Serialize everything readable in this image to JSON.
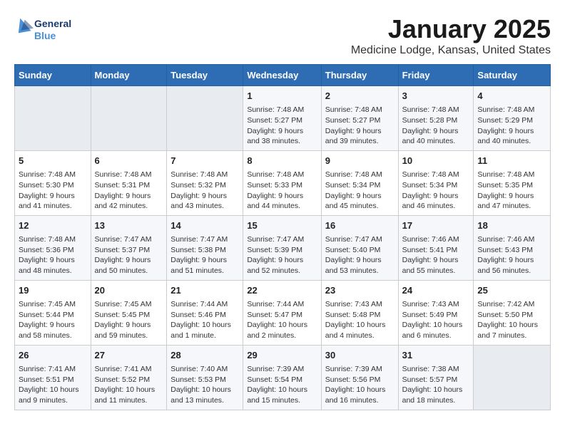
{
  "header": {
    "logo_line1": "General",
    "logo_line2": "Blue",
    "title": "January 2025",
    "subtitle": "Medicine Lodge, Kansas, United States"
  },
  "days_of_week": [
    "Sunday",
    "Monday",
    "Tuesday",
    "Wednesday",
    "Thursday",
    "Friday",
    "Saturday"
  ],
  "weeks": [
    [
      {
        "day": "",
        "info": ""
      },
      {
        "day": "",
        "info": ""
      },
      {
        "day": "",
        "info": ""
      },
      {
        "day": "1",
        "info": "Sunrise: 7:48 AM\nSunset: 5:27 PM\nDaylight: 9 hours and 38 minutes."
      },
      {
        "day": "2",
        "info": "Sunrise: 7:48 AM\nSunset: 5:27 PM\nDaylight: 9 hours and 39 minutes."
      },
      {
        "day": "3",
        "info": "Sunrise: 7:48 AM\nSunset: 5:28 PM\nDaylight: 9 hours and 40 minutes."
      },
      {
        "day": "4",
        "info": "Sunrise: 7:48 AM\nSunset: 5:29 PM\nDaylight: 9 hours and 40 minutes."
      }
    ],
    [
      {
        "day": "5",
        "info": "Sunrise: 7:48 AM\nSunset: 5:30 PM\nDaylight: 9 hours and 41 minutes."
      },
      {
        "day": "6",
        "info": "Sunrise: 7:48 AM\nSunset: 5:31 PM\nDaylight: 9 hours and 42 minutes."
      },
      {
        "day": "7",
        "info": "Sunrise: 7:48 AM\nSunset: 5:32 PM\nDaylight: 9 hours and 43 minutes."
      },
      {
        "day": "8",
        "info": "Sunrise: 7:48 AM\nSunset: 5:33 PM\nDaylight: 9 hours and 44 minutes."
      },
      {
        "day": "9",
        "info": "Sunrise: 7:48 AM\nSunset: 5:34 PM\nDaylight: 9 hours and 45 minutes."
      },
      {
        "day": "10",
        "info": "Sunrise: 7:48 AM\nSunset: 5:34 PM\nDaylight: 9 hours and 46 minutes."
      },
      {
        "day": "11",
        "info": "Sunrise: 7:48 AM\nSunset: 5:35 PM\nDaylight: 9 hours and 47 minutes."
      }
    ],
    [
      {
        "day": "12",
        "info": "Sunrise: 7:48 AM\nSunset: 5:36 PM\nDaylight: 9 hours and 48 minutes."
      },
      {
        "day": "13",
        "info": "Sunrise: 7:47 AM\nSunset: 5:37 PM\nDaylight: 9 hours and 50 minutes."
      },
      {
        "day": "14",
        "info": "Sunrise: 7:47 AM\nSunset: 5:38 PM\nDaylight: 9 hours and 51 minutes."
      },
      {
        "day": "15",
        "info": "Sunrise: 7:47 AM\nSunset: 5:39 PM\nDaylight: 9 hours and 52 minutes."
      },
      {
        "day": "16",
        "info": "Sunrise: 7:47 AM\nSunset: 5:40 PM\nDaylight: 9 hours and 53 minutes."
      },
      {
        "day": "17",
        "info": "Sunrise: 7:46 AM\nSunset: 5:41 PM\nDaylight: 9 hours and 55 minutes."
      },
      {
        "day": "18",
        "info": "Sunrise: 7:46 AM\nSunset: 5:43 PM\nDaylight: 9 hours and 56 minutes."
      }
    ],
    [
      {
        "day": "19",
        "info": "Sunrise: 7:45 AM\nSunset: 5:44 PM\nDaylight: 9 hours and 58 minutes."
      },
      {
        "day": "20",
        "info": "Sunrise: 7:45 AM\nSunset: 5:45 PM\nDaylight: 9 hours and 59 minutes."
      },
      {
        "day": "21",
        "info": "Sunrise: 7:44 AM\nSunset: 5:46 PM\nDaylight: 10 hours and 1 minute."
      },
      {
        "day": "22",
        "info": "Sunrise: 7:44 AM\nSunset: 5:47 PM\nDaylight: 10 hours and 2 minutes."
      },
      {
        "day": "23",
        "info": "Sunrise: 7:43 AM\nSunset: 5:48 PM\nDaylight: 10 hours and 4 minutes."
      },
      {
        "day": "24",
        "info": "Sunrise: 7:43 AM\nSunset: 5:49 PM\nDaylight: 10 hours and 6 minutes."
      },
      {
        "day": "25",
        "info": "Sunrise: 7:42 AM\nSunset: 5:50 PM\nDaylight: 10 hours and 7 minutes."
      }
    ],
    [
      {
        "day": "26",
        "info": "Sunrise: 7:41 AM\nSunset: 5:51 PM\nDaylight: 10 hours and 9 minutes."
      },
      {
        "day": "27",
        "info": "Sunrise: 7:41 AM\nSunset: 5:52 PM\nDaylight: 10 hours and 11 minutes."
      },
      {
        "day": "28",
        "info": "Sunrise: 7:40 AM\nSunset: 5:53 PM\nDaylight: 10 hours and 13 minutes."
      },
      {
        "day": "29",
        "info": "Sunrise: 7:39 AM\nSunset: 5:54 PM\nDaylight: 10 hours and 15 minutes."
      },
      {
        "day": "30",
        "info": "Sunrise: 7:39 AM\nSunset: 5:56 PM\nDaylight: 10 hours and 16 minutes."
      },
      {
        "day": "31",
        "info": "Sunrise: 7:38 AM\nSunset: 5:57 PM\nDaylight: 10 hours and 18 minutes."
      },
      {
        "day": "",
        "info": ""
      }
    ]
  ]
}
